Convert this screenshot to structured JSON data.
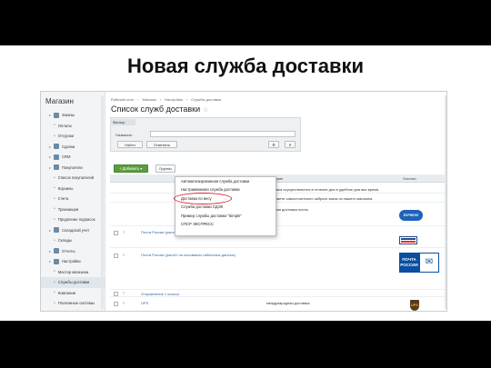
{
  "slide": {
    "title": "Новая служба доставки"
  },
  "sidebar": {
    "header": "Магазин",
    "items": [
      {
        "label": "Заказы",
        "level": 1
      },
      {
        "label": "Оплаты",
        "level": 2
      },
      {
        "label": "Отгрузки",
        "level": 2
      },
      {
        "label": "Сделки",
        "level": 1
      },
      {
        "label": "CRM",
        "level": 1
      },
      {
        "label": "Покупатели",
        "level": 1
      },
      {
        "label": "Список покупателей",
        "level": 2
      },
      {
        "label": "Корзины",
        "level": 2
      },
      {
        "label": "Счета",
        "level": 2
      },
      {
        "label": "Транзакции",
        "level": 2
      },
      {
        "label": "Продление подписок",
        "level": 2
      },
      {
        "label": "Складской учет",
        "level": 1
      },
      {
        "label": "Склады",
        "level": 2
      },
      {
        "label": "Отчеты",
        "level": 1
      },
      {
        "label": "Настройки",
        "level": 1
      },
      {
        "label": "Мастер магазина",
        "level": 2
      },
      {
        "label": "Службы доставки",
        "level": 2,
        "active": true
      },
      {
        "label": "Компании",
        "level": 2
      },
      {
        "label": "Платежные системы",
        "level": 2
      }
    ]
  },
  "main": {
    "breadcrumbs": [
      "Рабочий стол",
      "Магазин",
      "Настройки",
      "Службы доставки"
    ],
    "title": "Список служб доставки",
    "filter": {
      "tab": "Фильтр",
      "label": "Название:",
      "find_button": "Найти",
      "cancel_button": "Отменить"
    },
    "toolbar": {
      "add_button": "Добавить",
      "groups_button": "Группы"
    },
    "table": {
      "col_description": "Описание",
      "col_logo": "Логотип",
      "rows": [
        {
          "name": "",
          "desc": "Доставка осуществляется в течение дня в удобное для вас время."
        },
        {
          "name": "",
          "desc": "Вы можете самостоятельно забрать заказ из нашего магазина."
        },
        {
          "name": "",
          "desc": "Срочная доставка почты",
          "logo": "express-logo"
        },
        {
          "name": "Почта России (расчёт на основании данных с сервера почты)",
          "desc": "",
          "logo": "russia-flag-logo"
        },
        {
          "name": "Почта России (расчёт на основании табличных данных)",
          "desc": "",
          "logo": "russian-post-logo"
        },
        {
          "name": "Отправление 1 класса",
          "desc": ""
        },
        {
          "name": "UPS",
          "desc": "международная доставка",
          "logo": "ups-logo"
        }
      ]
    },
    "dropdown": {
      "items": [
        "Автоматизированная служба доставки",
        "Настраиваемая служба доставки",
        "Доставка по весу",
        "Служба доставки СДЭК",
        "Пример службы доставки \"Simple\"",
        "СПСР ЭКСПРЕСС"
      ],
      "highlighted_index": 2
    },
    "logos": {
      "express": "EXPRESS",
      "post_text": "ПОЧТА РОССИИ",
      "ups": "UPS"
    }
  }
}
